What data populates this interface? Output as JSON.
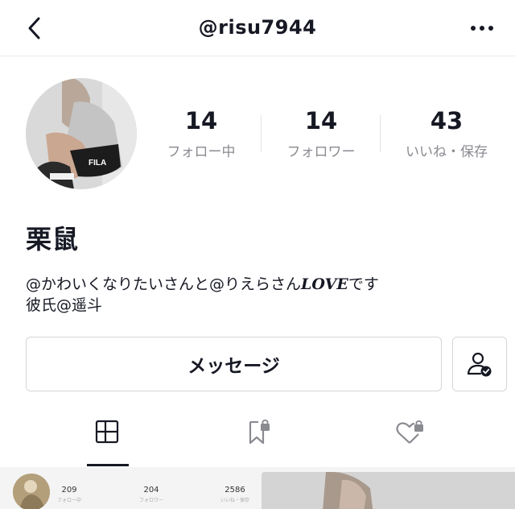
{
  "header": {
    "username": "@risu7944",
    "back_icon": "chevron-left-icon",
    "more_icon": "more-horizontal-icon"
  },
  "stats": [
    {
      "value": "14",
      "label": "フォロー中"
    },
    {
      "value": "14",
      "label": "フォロワー"
    },
    {
      "value": "43",
      "label": "いいね・保存"
    }
  ],
  "profile": {
    "display_name": "栗鼠",
    "bio_line1_part1": "@かわいくなりたいさんと@りえらさん",
    "bio_line1_love": "LOVE",
    "bio_line1_part2": "です",
    "bio_line2": "彼氏@遥斗",
    "avatar_icon": "profile-avatar-photo"
  },
  "actions": {
    "message_label": "メッセージ",
    "follow_icon": "user-check-icon"
  },
  "tabs": [
    {
      "name": "posts",
      "icon": "grid-icon",
      "active": true
    },
    {
      "name": "saved",
      "icon": "bookmark-lock-icon",
      "active": false
    },
    {
      "name": "liked",
      "icon": "heart-lock-icon",
      "active": false
    }
  ],
  "next_card": {
    "stats": [
      {
        "value": "209",
        "label": "フォロー中"
      },
      {
        "value": "204",
        "label": "フォロワー"
      },
      {
        "value": "2586",
        "label": "いいね・保存"
      }
    ]
  },
  "colors": {
    "text_primary": "#161823",
    "text_secondary": "#8a8b91",
    "border": "#d6d6d9"
  }
}
